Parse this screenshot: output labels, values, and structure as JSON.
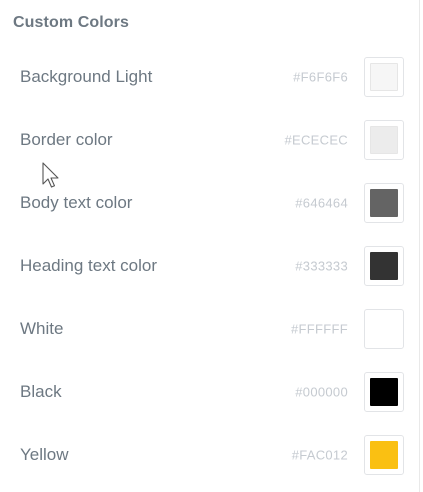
{
  "section": {
    "title": "Custom Colors"
  },
  "colors": [
    {
      "name": "Background Light",
      "hex": "#F6F6F6",
      "swatch": "#F6F6F6"
    },
    {
      "name": "Border color",
      "hex": "#ECECEC",
      "swatch": "#ECECEC"
    },
    {
      "name": "Body text color",
      "hex": "#646464",
      "swatch": "#646464"
    },
    {
      "name": "Heading text color",
      "hex": "#333333",
      "swatch": "#333333"
    },
    {
      "name": "White",
      "hex": "#FFFFFF",
      "swatch": "#FFFFFF"
    },
    {
      "name": "Black",
      "hex": "#000000",
      "swatch": "#000000"
    },
    {
      "name": "Yellow",
      "hex": "#FAC012",
      "swatch": "#FAC012"
    }
  ],
  "theme": {
    "label_color": "#6D7882",
    "hex_color": "#C5CAD0",
    "swatch_border": "#E2E4E7"
  },
  "icons": {
    "cursor": "mouse-pointer-icon"
  }
}
